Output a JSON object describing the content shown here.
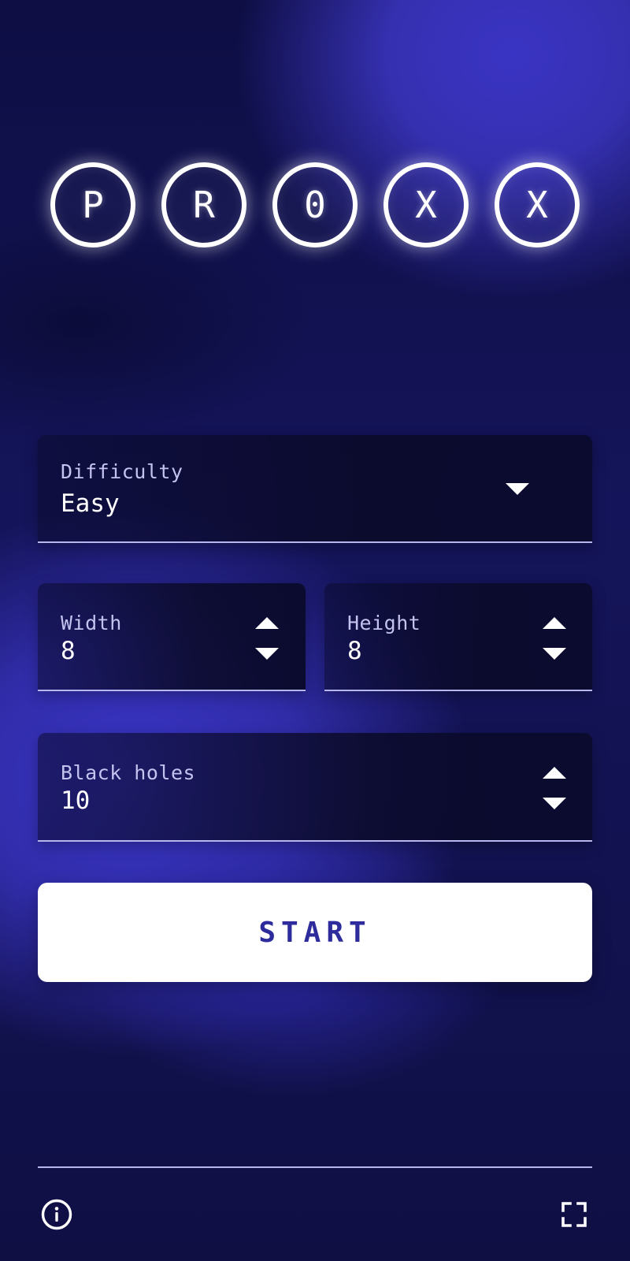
{
  "logo": {
    "letters": [
      "P",
      "R",
      "0",
      "X",
      "X"
    ]
  },
  "difficulty": {
    "label": "Difficulty",
    "value": "Easy"
  },
  "width": {
    "label": "Width",
    "value": "8"
  },
  "height": {
    "label": "Height",
    "value": "8"
  },
  "black_holes": {
    "label": "Black holes",
    "value": "10"
  },
  "start_label": "START",
  "icons": {
    "info": "info-icon",
    "fullscreen": "fullscreen-icon"
  },
  "colors": {
    "accent": "#2e2b9c",
    "background": "#14145a",
    "glow": "#ffffff"
  }
}
